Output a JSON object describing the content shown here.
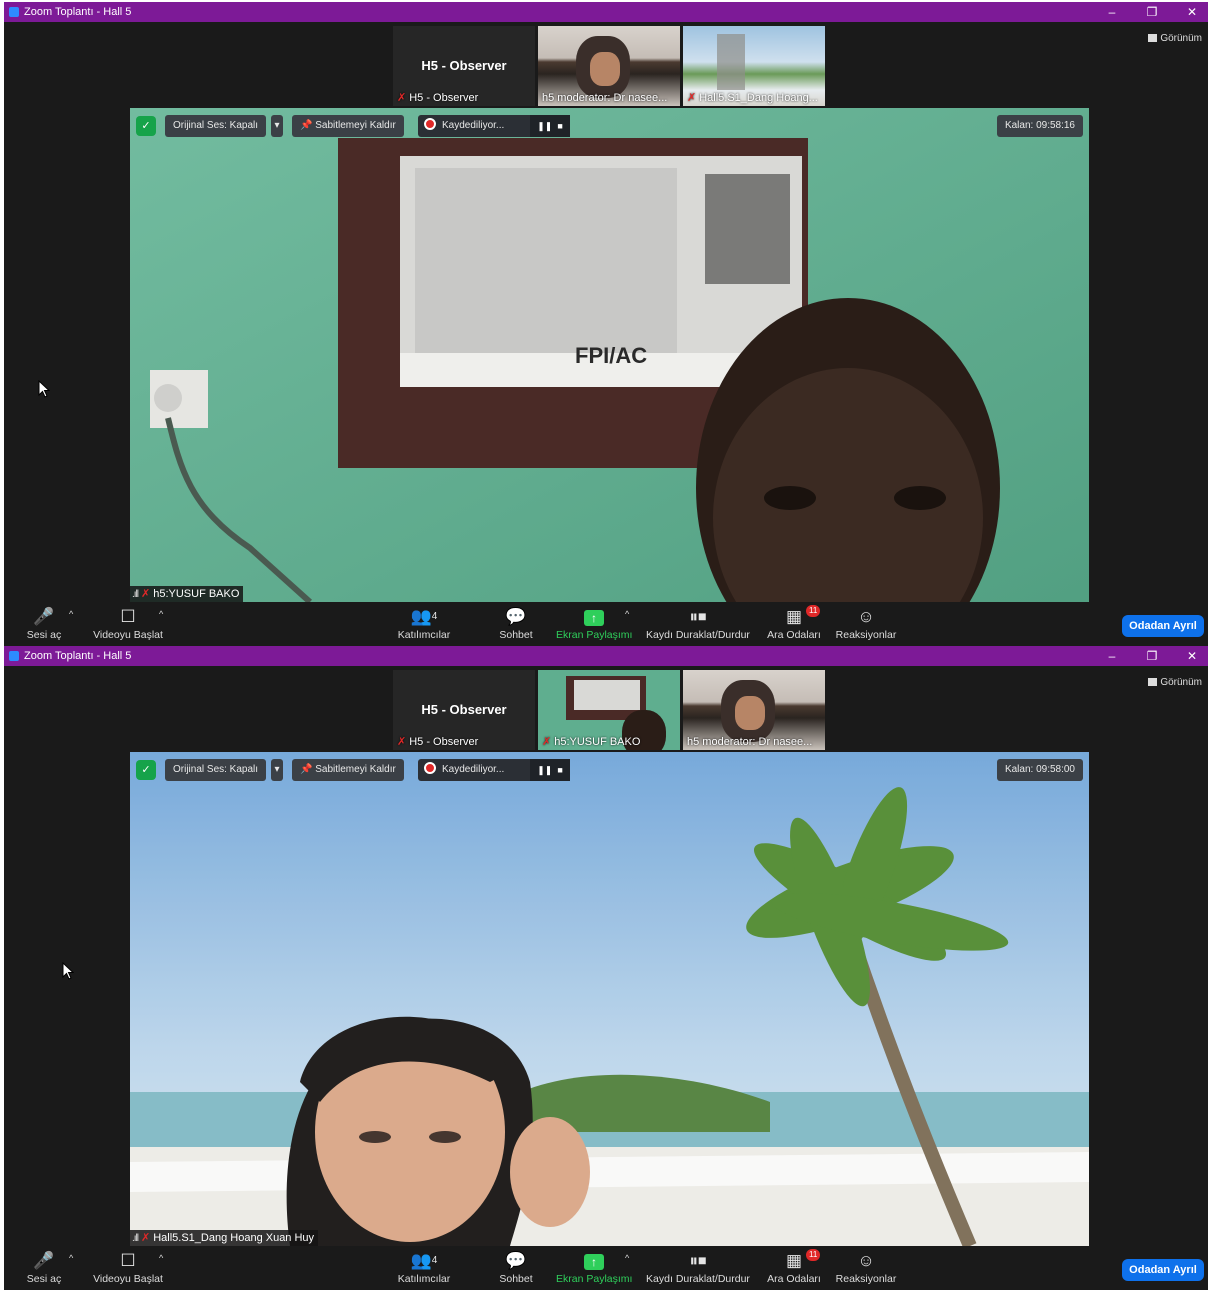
{
  "windows": [
    {
      "title": "Zoom Toplantı - Hall 5",
      "view_label": "Görünüm",
      "strip": {
        "observer_title": "H5 - Observer",
        "tiles": [
          "H5 - Observer",
          "h5 moderator: Dr nasee...",
          "Hall5.S1_Dang Hoang..."
        ]
      },
      "main": {
        "original_audio": "Orijinal Ses: Kapalı",
        "unpin": "Sabitlemeyi Kaldır",
        "recording": "Kaydediliyor...",
        "remaining": "Kalan: 09:58:16",
        "speaker": "h5:YUSUF BAKO"
      }
    },
    {
      "title": "Zoom Toplantı - Hall 5",
      "view_label": "Görünüm",
      "strip": {
        "observer_title": "H5 - Observer",
        "tiles": [
          "H5 - Observer",
          "h5:YUSUF BAKO",
          "h5 moderator: Dr nasee..."
        ]
      },
      "main": {
        "original_audio": "Orijinal Ses: Kapalı",
        "unpin": "Sabitlemeyi Kaldır",
        "recording": "Kaydediliyor...",
        "remaining": "Kalan: 09:58:00",
        "speaker": "Hall5.S1_Dang Hoang Xuan Huy"
      }
    }
  ],
  "toolbar": {
    "unmute": "Sesi aç",
    "start_video": "Videoyu Başlat",
    "participants": "Katılımcılar",
    "participants_count": "4",
    "chat": "Sohbet",
    "share_screen": "Ekran Paylaşımı",
    "pause_stop_recording": "Kaydı Duraklat/Durdur",
    "breakout_rooms": "Ara Odaları",
    "breakout_count": "11",
    "reactions": "Reaksiyonlar",
    "leave_room": "Odadan Ayrıl"
  },
  "colors": {
    "titlebar": "#7d1a97",
    "leave_button": "#0e71eb",
    "share_green": "#2fcf5b",
    "mute_red": "#e02828"
  }
}
